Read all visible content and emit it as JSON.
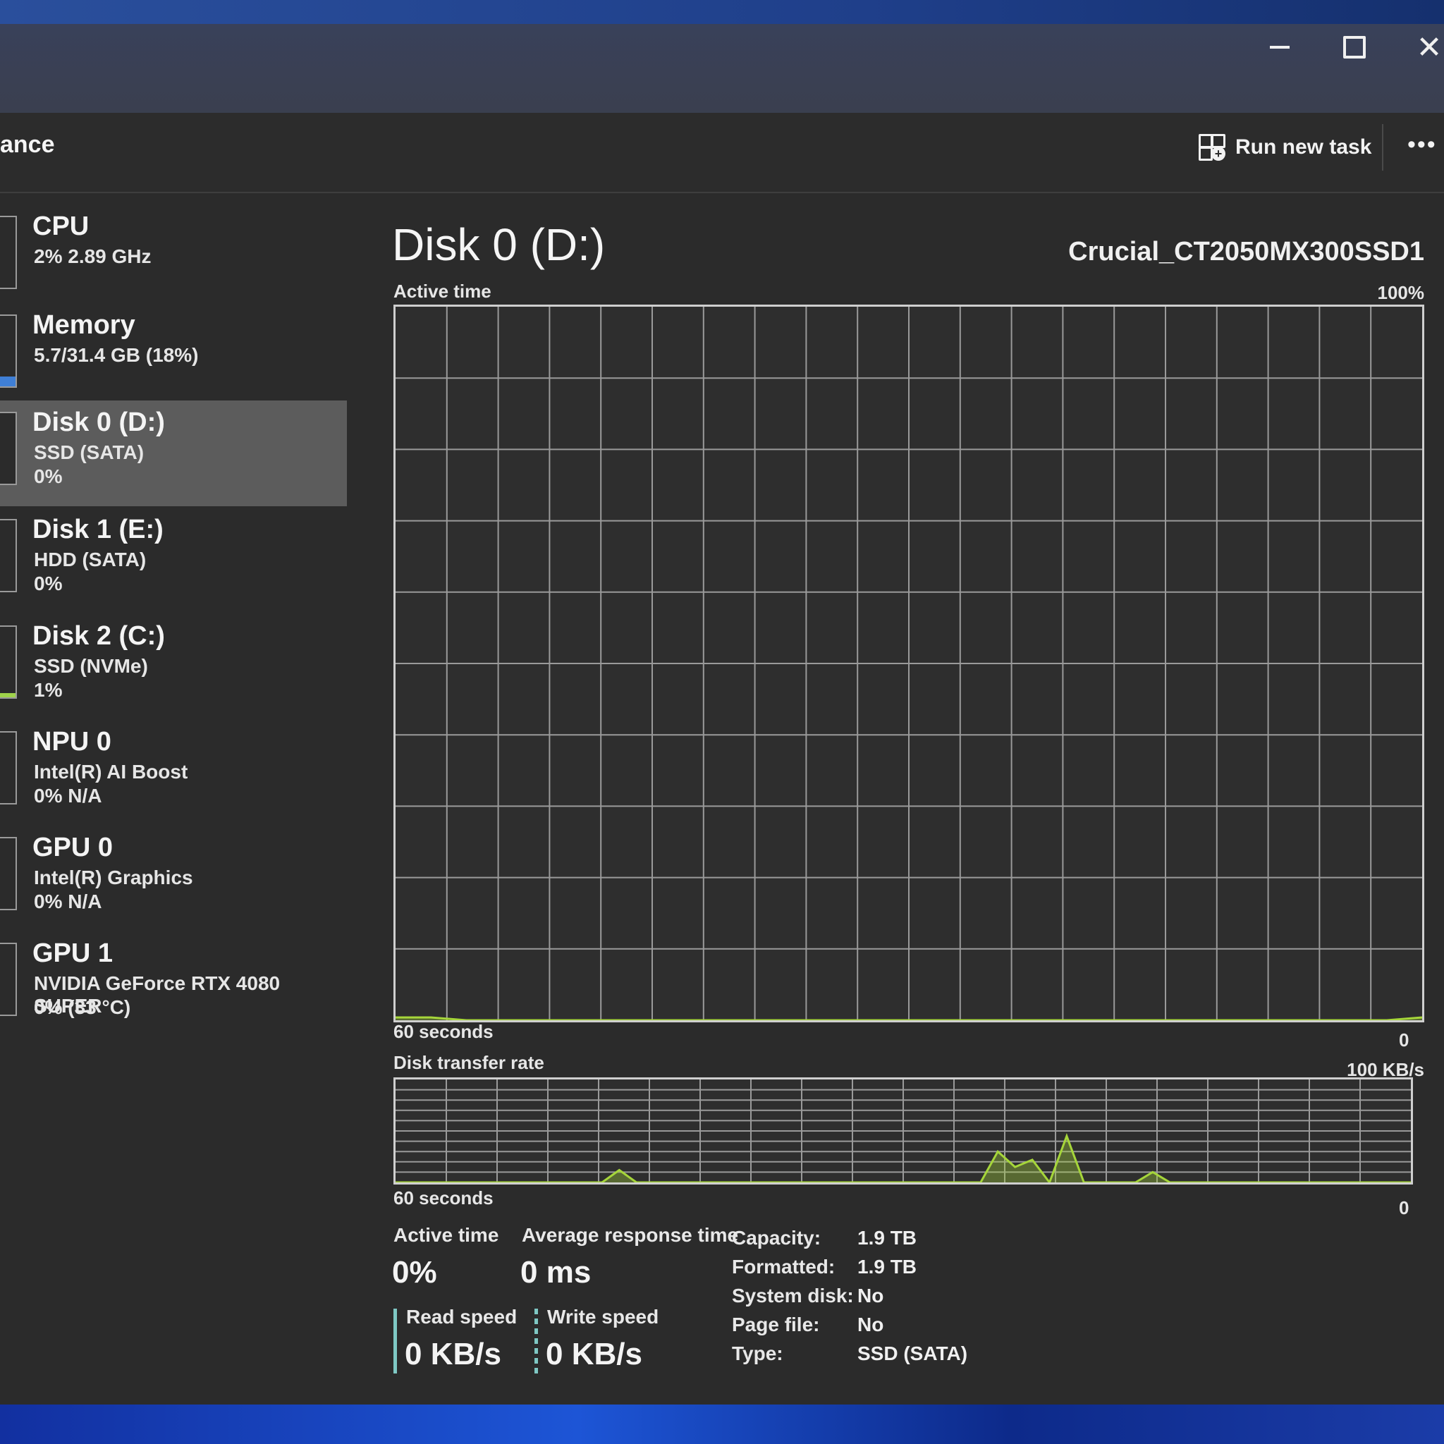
{
  "window": {
    "page_title": "ance",
    "run_new_task": "Run new task",
    "more": "•••"
  },
  "sidebar": {
    "items": [
      {
        "name": "CPU",
        "sub": "2% 2.89 GHz",
        "sub2": ""
      },
      {
        "name": "Memory",
        "sub": "5.7/31.4 GB (18%)",
        "sub2": ""
      },
      {
        "name": "Disk 0 (D:)",
        "sub": "SSD (SATA)",
        "sub2": "0%"
      },
      {
        "name": "Disk 1 (E:)",
        "sub": "HDD (SATA)",
        "sub2": "0%"
      },
      {
        "name": "Disk 2 (C:)",
        "sub": "SSD (NVMe)",
        "sub2": "1%"
      },
      {
        "name": "NPU 0",
        "sub": "Intel(R) AI Boost",
        "sub2": "0% N/A"
      },
      {
        "name": "GPU 0",
        "sub": "Intel(R) Graphics",
        "sub2": "0% N/A"
      },
      {
        "name": "GPU 1",
        "sub": "NVIDIA GeForce RTX 4080 SUPER",
        "sub2": "0% (33 °C)"
      }
    ],
    "selected_index": 2
  },
  "main": {
    "title": "Disk 0 (D:)",
    "model": "Crucial_CT2050MX300SSD1",
    "active_chart": {
      "label": "Active time",
      "max_label": "100%",
      "time_label": "60 seconds",
      "min_label": "0"
    },
    "transfer_chart": {
      "label": "Disk transfer rate",
      "max_label": "100 KB/s",
      "time_label": "60 seconds",
      "min_label": "0"
    },
    "stats": {
      "active_time_label": "Active time",
      "active_time_value": "0%",
      "avg_response_label": "Average response time",
      "avg_response_value": "0 ms",
      "read_label": "Read speed",
      "read_value": "0 KB/s",
      "write_label": "Write speed",
      "write_value": "0 KB/s"
    },
    "properties": {
      "capacity_label": "Capacity:",
      "capacity_value": "1.9 TB",
      "formatted_label": "Formatted:",
      "formatted_value": "1.9 TB",
      "system_disk_label": "System disk:",
      "system_disk_value": "No",
      "page_file_label": "Page file:",
      "page_file_value": "No",
      "type_label": "Type:",
      "type_value": "SSD (SATA)"
    }
  },
  "colors": {
    "graph_line": "#a6d63a",
    "grid": "#9a9a9a",
    "selected_bg": "#5c5c5c",
    "memory_accent": "#3f7fd6"
  },
  "chart_data": [
    {
      "type": "area",
      "title": "Active time",
      "ylim": [
        0,
        100
      ],
      "x_span_seconds": 60,
      "values": [
        0.4,
        0.4,
        0,
        0,
        0,
        0,
        0,
        0,
        0,
        0,
        0,
        0,
        0,
        0,
        0,
        0,
        0,
        0,
        0,
        0,
        0,
        0,
        0,
        0,
        0,
        0,
        0,
        0,
        0,
        0.4
      ]
    },
    {
      "type": "area",
      "title": "Disk transfer rate",
      "ylim": [
        0,
        100
      ],
      "unit": "KB/s",
      "x_span_seconds": 60,
      "values": [
        0,
        0,
        0,
        0,
        0,
        0,
        0,
        0,
        0,
        0,
        0,
        0,
        0,
        12,
        0,
        0,
        0,
        0,
        0,
        0,
        0,
        0,
        0,
        0,
        0,
        0,
        0,
        0,
        0,
        0,
        0,
        0,
        0,
        0,
        0,
        30,
        15,
        22,
        0,
        45,
        0,
        0,
        0,
        0,
        10,
        0,
        0,
        0,
        0,
        0,
        0,
        0,
        0,
        0,
        0,
        0,
        0,
        0,
        0,
        0
      ]
    }
  ]
}
